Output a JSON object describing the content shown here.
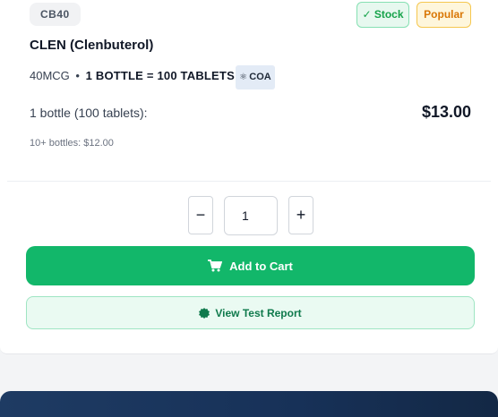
{
  "product": {
    "sku": "CB40",
    "stock_badge": "✓ Stock",
    "popular_badge": "Popular",
    "title": "CLEN (Clenbuterol)",
    "dosage": "40MCG",
    "separator": "•",
    "package": "1 BOTTLE = 100 TABLETS",
    "coa_label": "COA",
    "unit_label": "1 bottle (100 tablets):",
    "price": "$13.00",
    "bulk_price": "10+ bottles: $12.00"
  },
  "quantity": {
    "value": "1",
    "minus_symbol": "−",
    "plus_symbol": "+"
  },
  "actions": {
    "add_to_cart": "Add to Cart",
    "view_test_report": "View Test Report"
  },
  "colors": {
    "primary_green": "#12b76a",
    "stock_green": "#16a34a",
    "popular_amber": "#d97706",
    "banner_navy": "#1e3b63"
  }
}
